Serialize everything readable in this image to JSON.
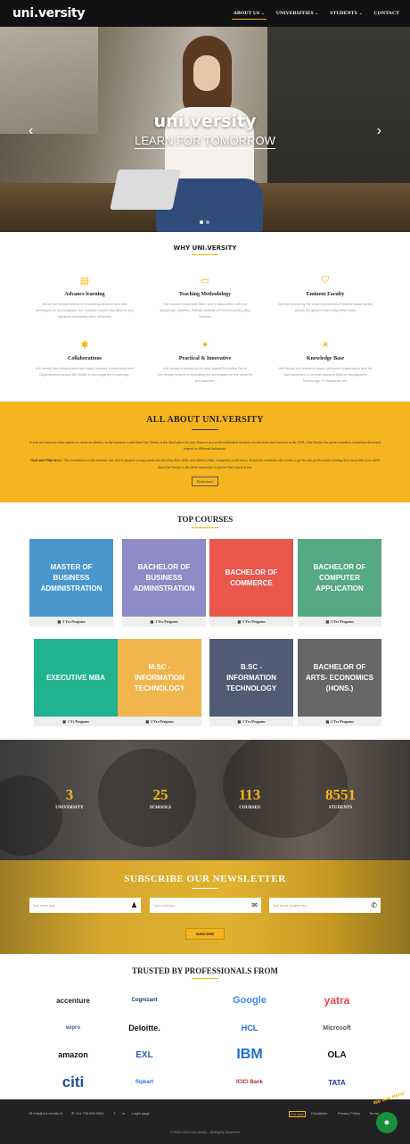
{
  "header": {
    "logo": "uni.versity",
    "nav": [
      {
        "label": "ABOUT US",
        "caret": "⌄"
      },
      {
        "label": "UNIVERSITIES",
        "caret": "⌄"
      },
      {
        "label": "STUDENTS",
        "caret": "⌄"
      },
      {
        "label": "CONTACT",
        "caret": ""
      }
    ]
  },
  "hero": {
    "title": "uni.versity",
    "subtitle": "LEARN FOR TOMORROW",
    "prev": "‹",
    "next": "›"
  },
  "why": {
    "title": "WHY UNI.VERSITY",
    "features": [
      {
        "icon": "book-icon",
        "glyph": "▤",
        "title": "Advance learning",
        "desc": "We at Uni.Versity believe in innovating advance and new techniques for the students. Our research based education is very advance comparing other university"
      },
      {
        "icon": "laptop-icon",
        "glyph": "▭",
        "title": "Teaching Methodology",
        "desc": "The conduct classroom team you in association with our knowledge partners -Sathak Institute LOYOLA teaching also Scandex"
      },
      {
        "icon": "graduation-cap-icon",
        "glyph": "⛉",
        "title": "Eminent Faculty",
        "desc": "Get the chance by the most experienced Eminent Salad faculty across the globe in their respective fields"
      },
      {
        "icon": "users-icon",
        "glyph": "✱",
        "title": "Collaborations",
        "desc": "Uni.Versity has collaboration with many Industry Consortiums and Organisations across the Globe to exchange the knowledge."
      },
      {
        "icon": "balance-icon",
        "glyph": "✦",
        "title": "Practical & Innovative",
        "desc": "Uni.Versity is known for its case based Education We at Uni.Versity believe in innovating the techniques for the students and business"
      },
      {
        "icon": "sun-icon",
        "glyph": "☀",
        "title": "Knowledge Base",
        "desc": "Uni.Versity is a research based renowned organisation and we have members in several research field on Management Technology, IT Healthcare etc."
      }
    ]
  },
  "about": {
    "title": "ALL ABOUT UNI.VERSITY",
    "p1": "If you are someone who aspires to create an identity in the business world then Uni.Versity is the ideal place for you. Known as a well-established institute of education and research in the USA, Uni.Versity has given countless trained professional experts to different industries.",
    "p2_label": "Goal and Objectives",
    "p2": " - The foundation of the institute was laid to prepare young minds and develop their skills and talent to their competent proficiency. If you are someone who wants to go for any professional training that can polish your skills then Uni.Versity is the ideal institution to pursue that course from.",
    "button": "Read more"
  },
  "courses": {
    "title": "TOP COURSES",
    "items": [
      {
        "title": "MASTER OF BUSINESS ADMINISTRATION",
        "duration": "2 Yrs Program",
        "color": "#4a97cf"
      },
      {
        "title": "BACHELOR OF BUSINESS ADMINISTRATION",
        "duration": "3 Yrs Program",
        "color": "#8f8bc6"
      },
      {
        "title": "BACHELOR OF COMMERCE",
        "duration": "3 Yrs Program",
        "color": "#e8574a"
      },
      {
        "title": "BACHELOR OF COMPUTER APPLICATION",
        "duration": "3 Yrs Program",
        "color": "#55a884"
      },
      {
        "title": "EXECUTIVE MBA",
        "duration": "1 Yr Program",
        "color": "#1fb391"
      },
      {
        "title": "M.SC - INFORMATION TECHNOLOGY",
        "duration": "2 Yrs Program",
        "color": "#f0b54c"
      },
      {
        "title": "B.SC - INFORMATION TECHNOLOGY",
        "duration": "3 Yrs Program",
        "color": "#505b74"
      },
      {
        "title": "BACHELOR OF ARTS- ECONOMICS (HONS.)",
        "duration": "3 Yrs Program",
        "color": "#666666"
      }
    ]
  },
  "stats": [
    {
      "num": "3",
      "label": "UNIVERSITY"
    },
    {
      "num": "25",
      "label": "SCHOOLS"
    },
    {
      "num": "113",
      "label": "COURSES"
    },
    {
      "num": "8551",
      "label": "STUDENTS"
    }
  ],
  "newsletter": {
    "title": "SUBSCRIBE OUR NEWSLETTER",
    "inputs": [
      {
        "placeholder": "Your name here",
        "icon": "user-icon",
        "glyph": "👤"
      },
      {
        "placeholder": "Your email here",
        "icon": "mail-icon",
        "glyph": "✉"
      },
      {
        "placeholder": "Your phone number here",
        "icon": "phone-icon",
        "glyph": "✆"
      }
    ],
    "button": "SUBSCRIBE"
  },
  "trusted": {
    "title": "TRUSTED BY PROFESSIONALS FROM",
    "logos": [
      {
        "name": "accenture",
        "color": "#222222"
      },
      {
        "name": "Cognizant",
        "color": "#1a3a6e"
      },
      {
        "name": "Google",
        "color": "#4285f4"
      },
      {
        "name": "yatra",
        "color": "#e8474e"
      },
      {
        "name": "wipro",
        "color": "#3b5aa8"
      },
      {
        "name": "Deloitte.",
        "color": "#111111"
      },
      {
        "name": "HCL",
        "color": "#1f6fc4"
      },
      {
        "name": "Microsoft",
        "color": "#555555"
      },
      {
        "name": "amazon",
        "color": "#111111"
      },
      {
        "name": "EXL",
        "color": "#2f5ea8"
      },
      {
        "name": "IBM",
        "color": "#1f70c1"
      },
      {
        "name": "OLA",
        "color": "#111111"
      },
      {
        "name": "citi",
        "color": "#1c4fa1"
      },
      {
        "name": "flipkart",
        "color": "#2874f0"
      },
      {
        "name": "ICICI Bank",
        "color": "#b02a2a"
      },
      {
        "name": "TATA",
        "color": "#1c3d8f"
      }
    ]
  },
  "footer": {
    "email": "info@uni.versity.in",
    "phone": "+91 733 890 9961",
    "login": "Login page",
    "links": [
      "For next",
      "Disclaimer",
      "Privacy Policy",
      "Terms"
    ],
    "copyright": "© 2020-2021 Uni.Versity - All Rights Reserved",
    "chat_tag": "We Are Here!"
  }
}
